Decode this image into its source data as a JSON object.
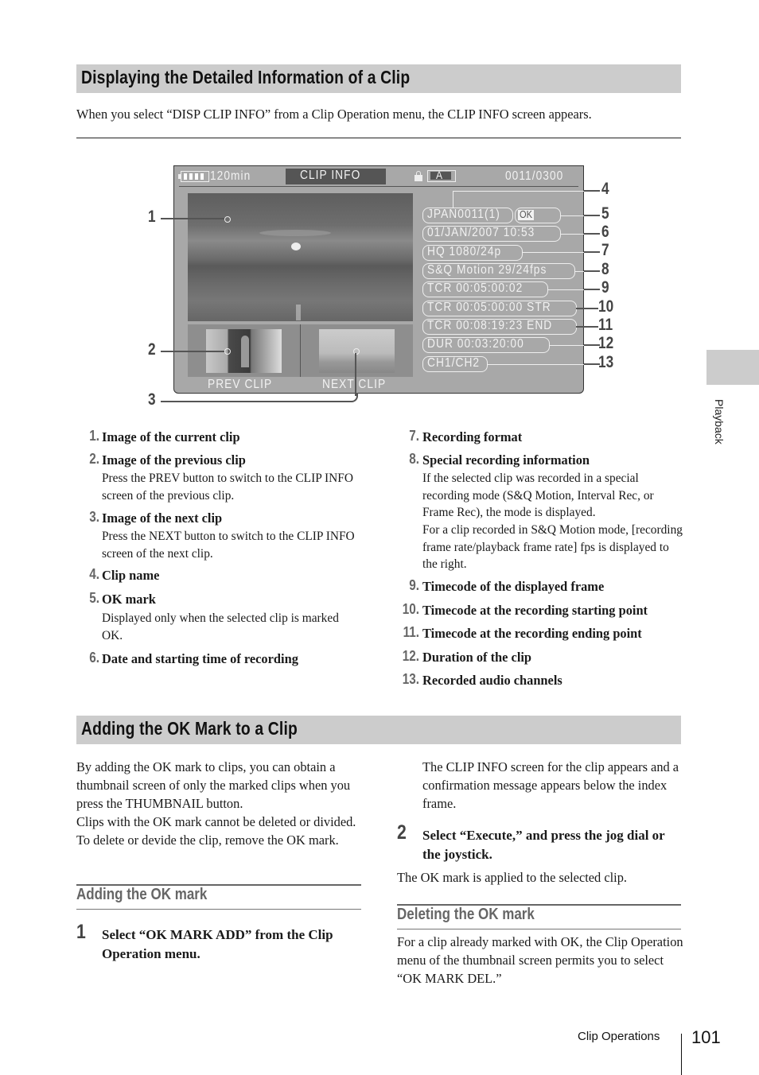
{
  "section1": {
    "title": "Displaying the Detailed Information of a Clip",
    "intro": "When you select “DISP CLIP INFO” from a Clip Operation menu, the CLIP INFO screen appears."
  },
  "screen": {
    "battery_icon": "battery-full-icon",
    "remaining": "120min",
    "title": "CLIP INFO",
    "lock_icon": "lock-icon",
    "media_slot": "A",
    "clip_counter": "0011/0300",
    "clip_name": "JPAN0011(1)",
    "ok_mark": "OK",
    "date_time": "01/JAN/2007 10:53",
    "format": "HQ 1080/24p",
    "special_rec": "S&Q Motion 29/24fps",
    "tcr_current": "TCR 00:05:00:02",
    "tcr_start": "TCR 00:05:00:00 STR",
    "tcr_end": "TCR 00:08:19:23 END",
    "duration": "DUR 00:03:20:00",
    "audio_channels": "CH1/CH2",
    "prev_label": "PREV CLIP",
    "next_label": "NEXT CLIP"
  },
  "callouts": [
    "1",
    "2",
    "3",
    "4",
    "5",
    "6",
    "7",
    "8",
    "9",
    "10",
    "11",
    "12",
    "13"
  ],
  "items_left": [
    {
      "num": "1.",
      "title": "Image of the current clip",
      "desc": ""
    },
    {
      "num": "2.",
      "title": "Image of the previous clip",
      "desc": "Press the PREV button to switch to the CLIP INFO screen of the previous clip."
    },
    {
      "num": "3.",
      "title": "Image of the next clip",
      "desc": "Press the NEXT button to switch to the CLIP INFO screen of the next clip."
    },
    {
      "num": "4.",
      "title": "Clip name",
      "desc": ""
    },
    {
      "num": "5.",
      "title": "OK mark",
      "desc": "Displayed only when the selected clip is marked OK."
    },
    {
      "num": "6.",
      "title": "Date and starting time of recording",
      "desc": ""
    }
  ],
  "items_right": [
    {
      "num": "7.",
      "title": "Recording format",
      "desc": ""
    },
    {
      "num": "8.",
      "title": "Special recording information",
      "desc": "If the selected clip was recorded in a special recording mode (S&Q Motion, Interval Rec, or Frame Rec), the mode is displayed.",
      "desc2": "For a clip recorded in S&Q Motion mode, [recording frame rate/playback frame rate] fps is displayed to the right."
    },
    {
      "num": "9.",
      "title": "Timecode of the displayed frame",
      "desc": ""
    },
    {
      "num": "10.",
      "title": "Timecode at the recording starting point",
      "desc": ""
    },
    {
      "num": "11.",
      "title": "Timecode at the recording ending point",
      "desc": ""
    },
    {
      "num": "12.",
      "title": "Duration of the clip",
      "desc": ""
    },
    {
      "num": "13.",
      "title": "Recorded audio channels",
      "desc": ""
    }
  ],
  "section2": {
    "title": "Adding the OK Mark to a Clip",
    "intro1": "By adding the OK mark to clips, you can obtain a thumbnail screen of only the marked clips when you press the THUMBNAIL button.",
    "intro2": "Clips with the OK mark cannot be deleted or divided. To delete or devide the clip, remove the OK mark.",
    "sub_add": "Adding the OK mark",
    "step1_num": "1",
    "step1_text": "Select “OK MARK ADD” from the Clip Operation menu.",
    "step1_result": "The CLIP INFO screen for the clip appears and a confirmation message appears below the index frame.",
    "step2_num": "2",
    "step2_text": "Select “Execute,” and press the jog dial or the joystick.",
    "step2_result": "The OK mark is applied to the selected clip.",
    "sub_delete": "Deleting the OK mark",
    "delete_text": "For a clip already marked with OK, the Clip Operation menu of the thumbnail screen permits you to select “OK MARK DEL.”"
  },
  "side_tab": {
    "label": "Playback"
  },
  "footer": {
    "section": "Clip Operations",
    "page": "101"
  }
}
